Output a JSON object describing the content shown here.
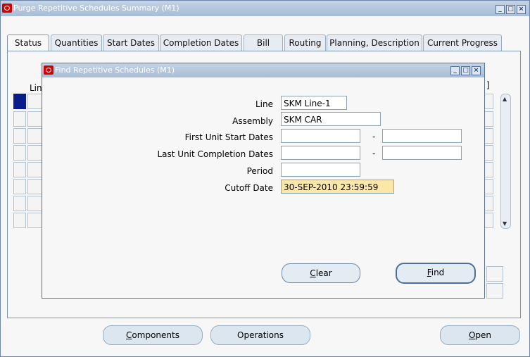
{
  "window": {
    "title": "Purge Repetitive Schedules Summary (M1)",
    "controls": [
      "minimize-icon",
      "maximize-icon",
      "close-icon"
    ]
  },
  "tabs": [
    {
      "label": "Status",
      "active": true
    },
    {
      "label": "Quantities"
    },
    {
      "label": "Start Dates"
    },
    {
      "label": "Completion Dates"
    },
    {
      "label": "Bill"
    },
    {
      "label": "Routing"
    },
    {
      "label": "Planning, Description"
    },
    {
      "label": "Current Progress"
    }
  ],
  "grid": {
    "column_header_fragment": "Lin",
    "bracket": "]"
  },
  "buttons": {
    "components": "Components",
    "operations": "Operations",
    "open": "Open"
  },
  "dialog": {
    "title": "Find Repetitive Schedules (M1)",
    "fields": {
      "line": {
        "label": "Line",
        "value": "SKM Line-1"
      },
      "assembly": {
        "label": "Assembly",
        "value": "SKM CAR"
      },
      "first_unit_start": {
        "label": "First Unit Start Dates",
        "from": "",
        "to": ""
      },
      "last_unit_completion": {
        "label": "Last Unit Completion Dates",
        "from": "",
        "to": ""
      },
      "period": {
        "label": "Period",
        "value": ""
      },
      "cutoff_date": {
        "label": "Cutoff Date",
        "value": "30-SEP-2010 23:59:59",
        "required_color": "#fbe8a8"
      }
    },
    "range_separator": "-",
    "buttons": {
      "clear": "Clear",
      "find": "Find"
    }
  },
  "colors": {
    "titlebar": "#a8bdd6",
    "oracle_logo": "#d40000",
    "selected_row_marker": "#0a1b8a"
  }
}
